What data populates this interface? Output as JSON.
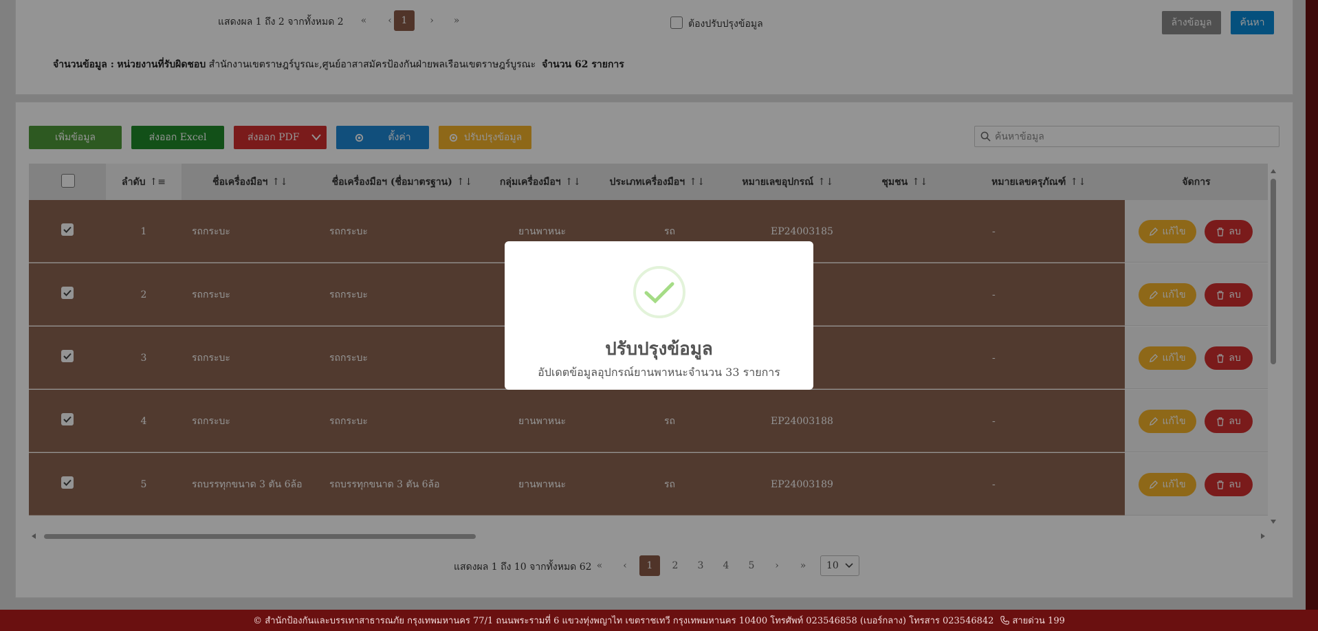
{
  "top_pager": {
    "info": "แสดงผล 1 ถึง 2 จากทั้งหมด 2",
    "first": "«",
    "prev": "‹",
    "current": "1",
    "next": "›",
    "last": "»"
  },
  "filter": {
    "needs_update_label": "ต้องปรับปรุงข้อมูล",
    "clear_label": "ล้างข้อมูล",
    "search_label": "ค้นหา"
  },
  "summary": {
    "label": "จำนวนข้อมูล :",
    "unit_label": "หน่วยงานที่รับผิดชอบ",
    "unit_value": "สำนักงานเขตราษฎร์บูรณะ,ศูนย์อาสาสมัครป้องกันฝ่ายพลเรือนเขตราษฎร์บูรณะ",
    "count_text": "จำนวน 62 รายการ"
  },
  "toolbar": {
    "add": "เพิ่มข้อมูล",
    "export_excel": "ส่งออก Excel",
    "export_pdf": "ส่งออก PDF",
    "settings": "ตั้งค่า",
    "update": "ปรับปรุงข้อมูล",
    "search_placeholder": "ค้นหาข้อมูล"
  },
  "table": {
    "headers": [
      "ลำดับ",
      "ชื่อเครื่องมือฯ",
      "ชื่อเครื่องมือฯ (ชื่อมาตรฐาน)",
      "กลุ่มเครื่องมือฯ",
      "ประเภทเครื่องมือฯ",
      "หมายเลขอุปกรณ์",
      "ชุมชน",
      "หมายเลขครุภัณฑ์",
      "จัดการ"
    ],
    "edit_label": "แก้ไข",
    "delete_label": "ลบ",
    "rows": [
      {
        "no": "1",
        "name": "รถกระบะ",
        "std_name": "รถกระบะ",
        "group": "ยานพาหนะ",
        "type": "รถ",
        "device_no": "EP24003185",
        "community": "",
        "asset_no": "-"
      },
      {
        "no": "2",
        "name": "รถกระบะ",
        "std_name": "รถกระบะ",
        "group": "",
        "type": "",
        "device_no": "86",
        "community": "",
        "asset_no": "-"
      },
      {
        "no": "3",
        "name": "รถกระบะ",
        "std_name": "รถกระบะ",
        "group": "",
        "type": "",
        "device_no": "87",
        "community": "",
        "asset_no": "-"
      },
      {
        "no": "4",
        "name": "รถกระบะ",
        "std_name": "รถกระบะ",
        "group": "ยานพาหนะ",
        "type": "รถ",
        "device_no": "EP24003188",
        "community": "",
        "asset_no": "-"
      },
      {
        "no": "5",
        "name": "รถบรรทุกขนาด 3 ตัน 6ล้อ",
        "std_name": "รถบรรทุกขนาด 3 ตัน 6ล้อ",
        "group": "ยานพาหนะ",
        "type": "รถ",
        "device_no": "EP24003189",
        "community": "",
        "asset_no": "-"
      }
    ]
  },
  "bottom_pager": {
    "info": "แสดงผล 1 ถึง 10 จากทั้งหมด 62",
    "first": "«",
    "prev": "‹",
    "pages": [
      "1",
      "2",
      "3",
      "4",
      "5"
    ],
    "next": "›",
    "last": "»",
    "page_size": "10"
  },
  "modal": {
    "title": "ปรับปรุงข้อมูล",
    "message": "อัปเดตข้อมูลอุปกรณ์ยานพาหนะจำนวน 33 รายการ"
  },
  "footer": {
    "text": "© สำนักป้องกันและบรรเทาสาธารณภัย กรุงเทพมหานคร 77/1 ถนนพระรามที่ 6 แขวงทุ่งพญาไท เขตราชเทวี กรุงเทพมหานคร 10400 โทรศัพท์ 023546858 (เบอร์กลาง) โทรสาร 023546842",
    "hotline": "สายด่วน 199"
  },
  "colors": {
    "brand_dark_red": "#6a1010",
    "row_brown": "#8c6552",
    "add_green": "#4e9a3a",
    "excel_green": "#1f8a2a",
    "pdf_red": "#d32f2f",
    "settings_blue": "#1e88d6",
    "update_yellow": "#f5b42a",
    "search_blue": "#0a8ad8",
    "clear_gray": "#8a8a8a",
    "check_green": "#a5dc86"
  }
}
